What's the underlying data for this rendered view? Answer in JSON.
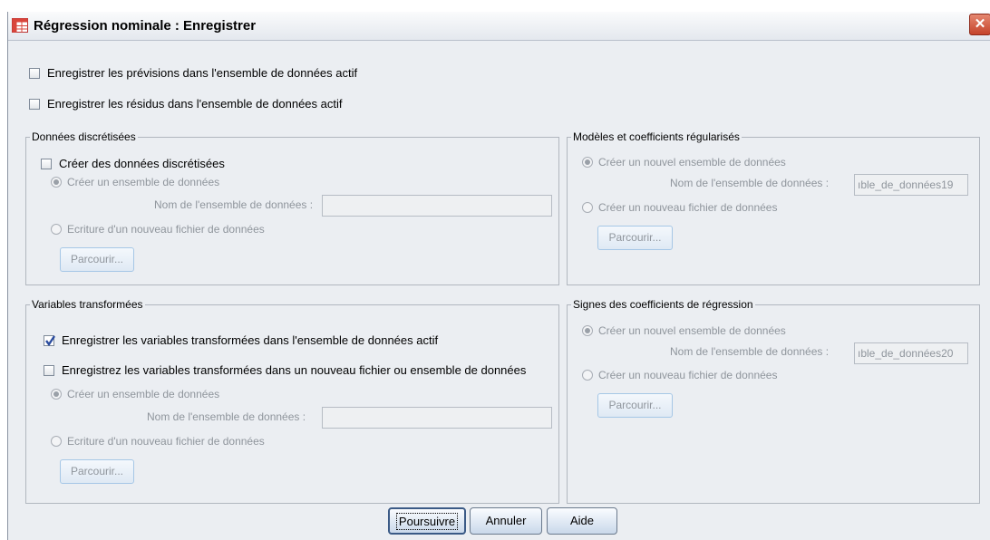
{
  "window": {
    "title": "Régression nominale : Enregistrer",
    "close_glyph": "✕"
  },
  "checks_top": {
    "save_predictions": "Enregistrer les prévisions dans l'ensemble de données actif",
    "save_residuals": "Enregistrer les résidus dans l'ensemble de données actif"
  },
  "discretized": {
    "title": "Données discrétisées",
    "create_check": "Créer des données discrétisées",
    "radio_dataset": "Créer un ensemble de données",
    "dataset_name_label": "Nom de l'ensemble de données :",
    "dataset_name_value": "",
    "radio_file": "Ecriture d'un nouveau fichier de données",
    "browse": "Parcourir..."
  },
  "models": {
    "title": "Modèles et coefficients régularisés",
    "radio_dataset": "Créer un nouvel ensemble de données",
    "dataset_name_label": "Nom de l'ensemble de données :",
    "dataset_name_value": "ıble_de_données19",
    "radio_file": "Créer un nouveau fichier de données",
    "browse": "Parcourir..."
  },
  "transformed": {
    "title": "Variables transformées",
    "save_active_check": "Enregistrer les variables transformées dans l'ensemble de données actif",
    "save_new_check": "Enregistrez les variables transformées dans un nouveau fichier ou ensemble de données",
    "radio_dataset": "Créer un ensemble de données",
    "dataset_name_label": "Nom de l'ensemble de données :",
    "dataset_name_value": "",
    "radio_file": "Ecriture d'un nouveau fichier de données",
    "browse": "Parcourir..."
  },
  "signs": {
    "title": "Signes des coefficients de régression",
    "radio_dataset": "Créer un nouvel ensemble de données",
    "dataset_name_label": "Nom de l'ensemble de données :",
    "dataset_name_value": "ıble_de_données20",
    "radio_file": "Créer un nouveau fichier de données",
    "browse": "Parcourir..."
  },
  "footer": {
    "continue": "Poursuivre",
    "cancel": "Annuler",
    "help": "Aide"
  }
}
